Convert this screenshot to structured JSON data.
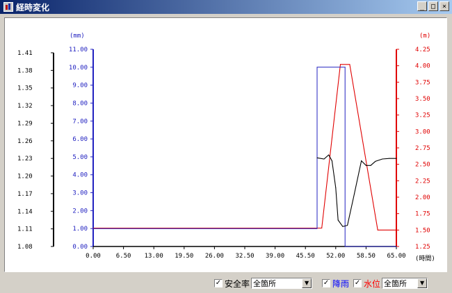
{
  "window": {
    "title": "経時変化",
    "buttons": [
      "_",
      "□",
      "×"
    ]
  },
  "controls": {
    "safety": {
      "label": "安全率",
      "checked": true,
      "select_value": "全箇所"
    },
    "rain": {
      "label": "降雨",
      "checked": true
    },
    "water": {
      "label": "水位",
      "checked": true,
      "select_value": "全箇所"
    }
  },
  "colors": {
    "safety": "#000000",
    "rain": "#2020c0",
    "water": "#e00000"
  },
  "chart_data": {
    "type": "line",
    "x": {
      "label": "(時間)",
      "ticks": [
        "0.00",
        "6.50",
        "13.00",
        "19.50",
        "26.00",
        "32.50",
        "39.00",
        "45.50",
        "52.00",
        "58.50",
        "65.00"
      ],
      "range": [
        0,
        65
      ]
    },
    "axes": {
      "safety": {
        "ticks": [
          "1.08",
          "1.11",
          "1.14",
          "1.17",
          "1.20",
          "1.23",
          "1.26",
          "1.29",
          "1.32",
          "1.35",
          "1.38",
          "1.41"
        ],
        "range": [
          1.08,
          1.41
        ]
      },
      "rain": {
        "unit": "(mm)",
        "ticks": [
          "0.00",
          "1.00",
          "2.00",
          "3.00",
          "4.00",
          "5.00",
          "6.00",
          "7.00",
          "8.00",
          "9.00",
          "10.00",
          "11.00"
        ],
        "range": [
          0,
          11
        ]
      },
      "water": {
        "unit": "(m)",
        "ticks": [
          "1.25",
          "1.50",
          "1.75",
          "2.00",
          "2.25",
          "2.50",
          "2.75",
          "3.00",
          "3.25",
          "3.50",
          "3.75",
          "4.00",
          "4.25"
        ],
        "range": [
          1.25,
          4.25
        ]
      }
    },
    "series": [
      {
        "key": "water",
        "axis": "water",
        "points": [
          [
            0,
            1.53
          ],
          [
            48,
            1.53
          ],
          [
            49,
            1.53
          ],
          [
            53,
            4.02
          ],
          [
            55,
            4.02
          ],
          [
            61,
            1.5
          ],
          [
            65,
            1.5
          ]
        ]
      },
      {
        "key": "rain",
        "axis": "rain",
        "steps": [
          [
            0,
            1.0
          ],
          [
            48,
            1.0
          ],
          [
            48,
            10.0
          ],
          [
            54,
            10.0
          ],
          [
            54,
            0
          ],
          [
            65,
            0
          ]
        ]
      },
      {
        "key": "safety",
        "axis": "safety",
        "points": [
          [
            48,
            1.231
          ],
          [
            49.5,
            1.229
          ],
          [
            50.5,
            1.236
          ],
          [
            51.2,
            1.226
          ],
          [
            52,
            1.18
          ],
          [
            52.5,
            1.125
          ],
          [
            53.5,
            1.114
          ],
          [
            54.5,
            1.116
          ],
          [
            56,
            1.17
          ],
          [
            57.5,
            1.226
          ],
          [
            58.5,
            1.218
          ],
          [
            59.5,
            1.218
          ],
          [
            60.5,
            1.225
          ],
          [
            62,
            1.229
          ],
          [
            63.5,
            1.23
          ],
          [
            65,
            1.23
          ]
        ]
      }
    ]
  }
}
